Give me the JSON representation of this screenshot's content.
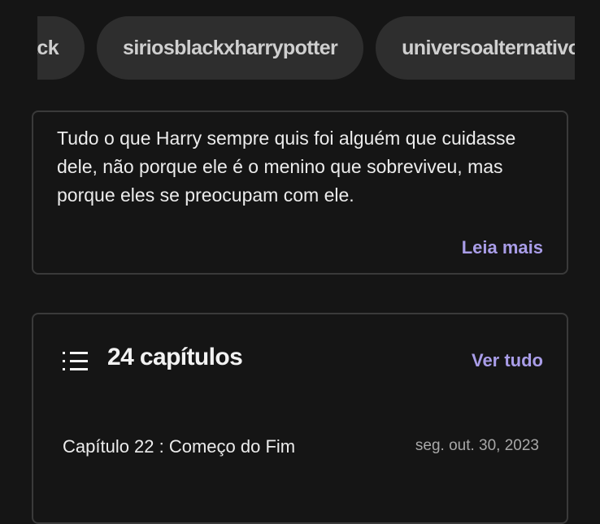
{
  "tags": [
    "siriusblack",
    "siriosblackxharrypotter",
    "universoalternativo"
  ],
  "description": {
    "text": "Tudo o que Harry sempre quis foi alguém que cuidasse dele, não porque ele é o menino que sobreviveu, mas porque eles se preocupam com ele.",
    "read_more_label": "Leia mais"
  },
  "chapters": {
    "count_label": "24 capítulos",
    "see_all_label": "Ver tudo",
    "icon": "list-icon",
    "items": [
      {
        "title": "Capítulo 22 : Começo do Fim",
        "date": "seg. out. 30, 2023"
      }
    ]
  },
  "colors": {
    "background": "#151515",
    "accent": "#a99de8",
    "chip": "#2e2e2e",
    "border": "#3a3a3a"
  }
}
